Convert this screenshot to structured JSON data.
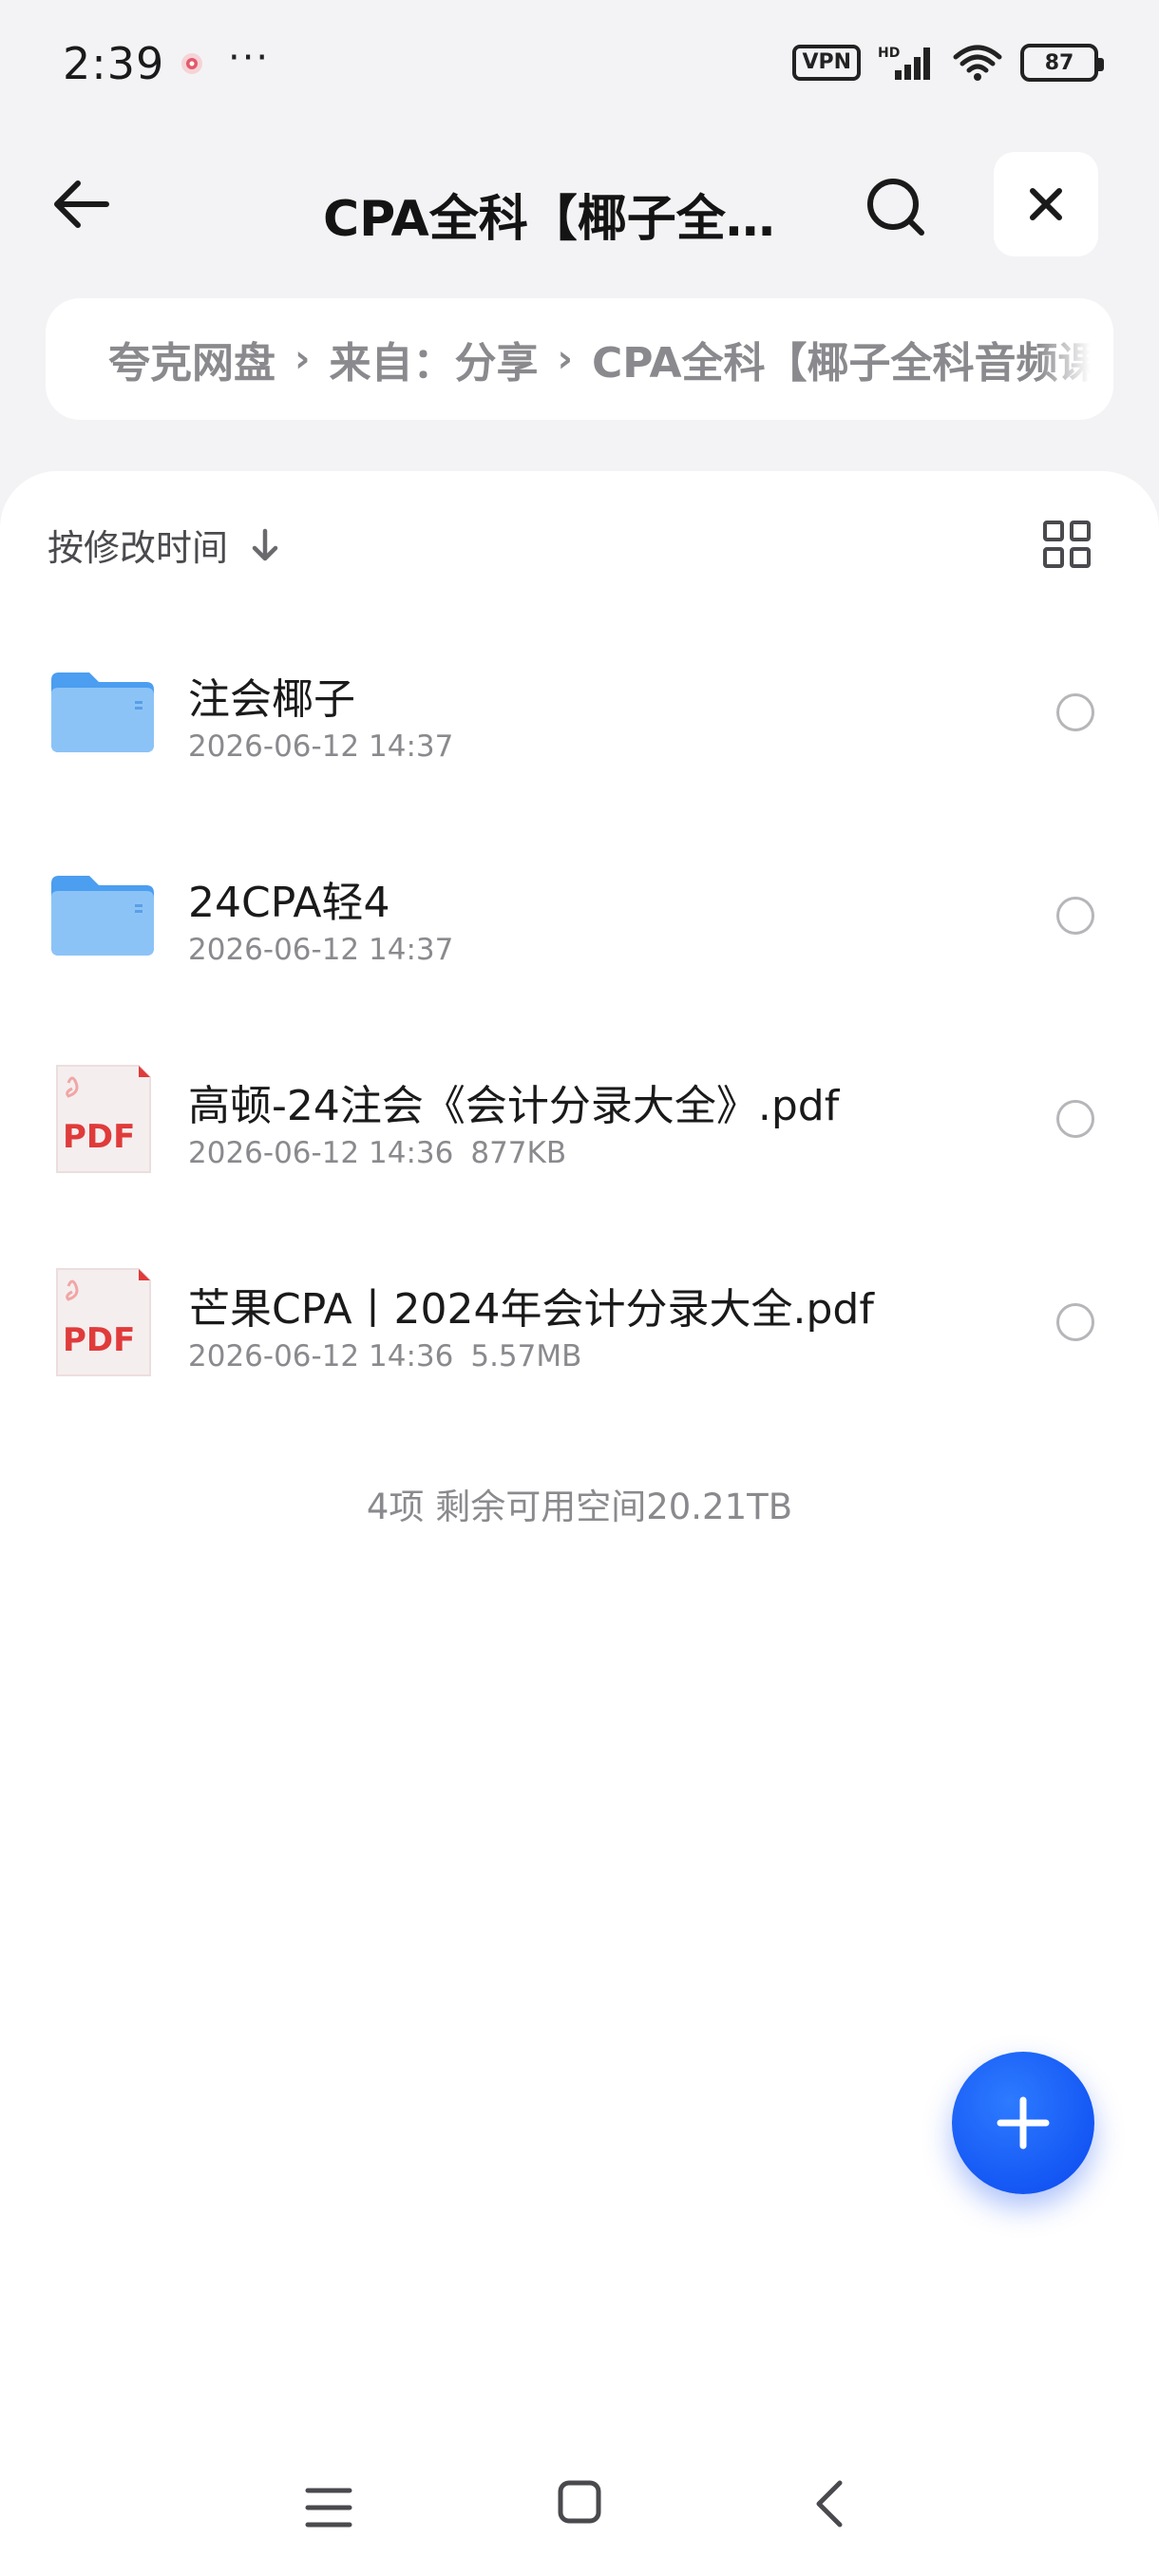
{
  "status_bar": {
    "time": "2:39",
    "dots": "···",
    "vpn": "VPN",
    "hd": "HD",
    "battery": "87"
  },
  "header": {
    "title": "CPA全科【椰子全科音频课】",
    "back_icon": "arrow-left-icon",
    "search_icon": "search-icon",
    "close_icon": "close-icon"
  },
  "breadcrumb": {
    "items": [
      "夸克网盘",
      "来自：分享",
      "CPA全科【椰子全科音频课】"
    ],
    "separator": "›"
  },
  "sort": {
    "label": "按修改时间",
    "icon": "arrow-down-icon",
    "view_icon": "grid-view-icon"
  },
  "files": [
    {
      "type": "folder",
      "name": "注会椰子",
      "date": "2026-06-12 14:37",
      "size": ""
    },
    {
      "type": "folder",
      "name": "24CPA轻4",
      "date": "2026-06-12 14:37",
      "size": ""
    },
    {
      "type": "pdf",
      "name": "高顿-24注会《会计分录大全》.pdf",
      "date": "2026-06-12 14:36",
      "size": "877KB"
    },
    {
      "type": "pdf",
      "name": "芒果CPA丨2024年会计分录大全.pdf",
      "date": "2026-06-12 14:36",
      "size": "5.57MB"
    }
  ],
  "file_icon_labels": {
    "pdf": "PDF"
  },
  "footer": {
    "info": "4项 剩余可用空间20.21TB"
  },
  "colors": {
    "accent": "#0a48f0",
    "folder": "#5aa8f2",
    "pdf_red": "#e03b3b",
    "muted_text": "#8a8a8e"
  },
  "nav": {
    "menu_icon": "menu-icon",
    "home_icon": "home-square-icon",
    "back_icon": "chevron-left-icon"
  }
}
